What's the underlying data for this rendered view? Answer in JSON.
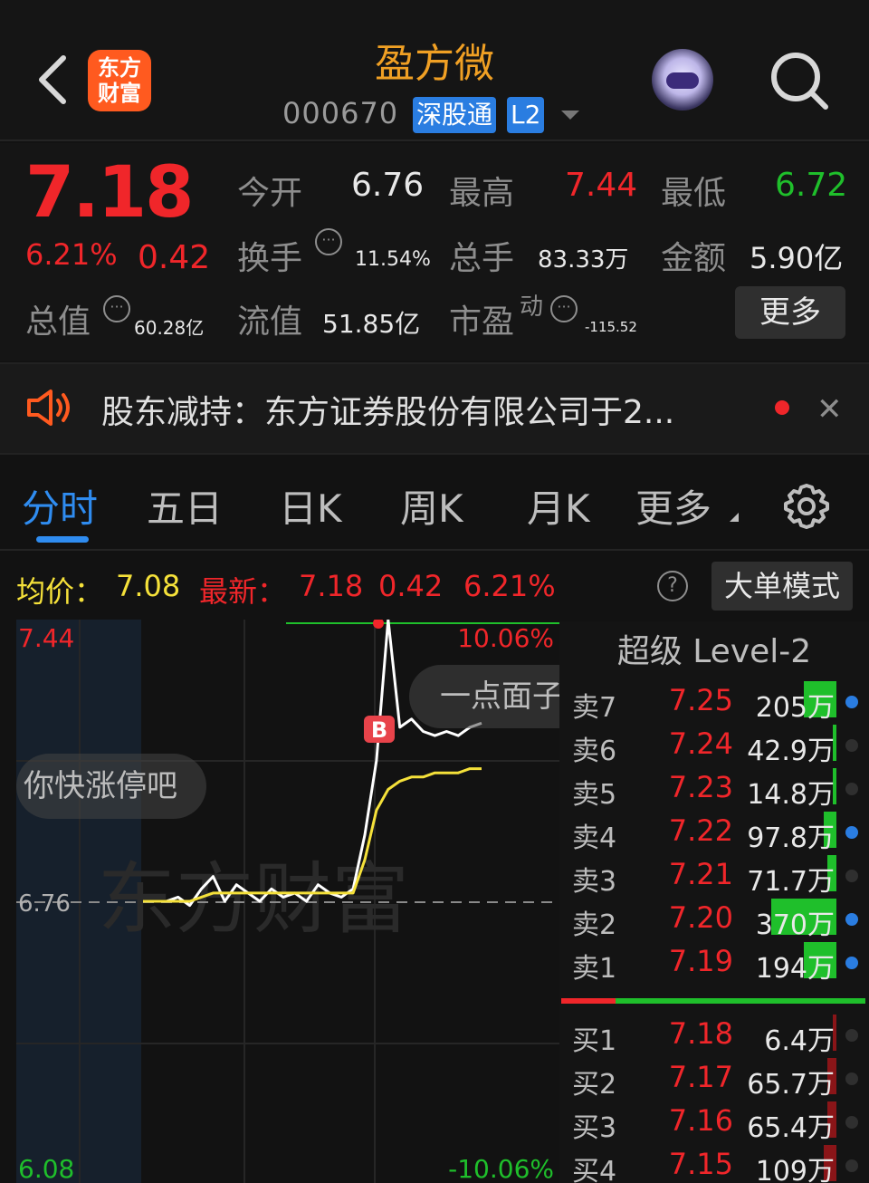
{
  "header": {
    "logo_line1": "东方",
    "logo_line2": "财富",
    "stock_name": "盈方微",
    "stock_code": "000670",
    "badge_sgt": "深股通",
    "badge_l2": "L2"
  },
  "quote": {
    "price": "7.18",
    "change_pct": "6.21%",
    "change": "0.42",
    "open_label": "今开",
    "open": "6.76",
    "high_label": "最高",
    "high": "7.44",
    "low_label": "最低",
    "low": "6.72",
    "turnover_label": "换手",
    "turnover": "11.54%",
    "volume_label": "总手",
    "volume": "83.33万",
    "amount_label": "金额",
    "amount": "5.90亿",
    "mktcap_label": "总值",
    "mktcap": "60.28亿",
    "float_label": "流值",
    "float_cap": "51.85亿",
    "pe_label": "市盈",
    "pe_sup": "动",
    "pe": "-115.52",
    "more_label": "更多",
    "info_glyph": "···"
  },
  "news": {
    "text": "股东减持：东方证券股份有限公司于2..."
  },
  "tabs": [
    "分时",
    "五日",
    "日K",
    "周K",
    "月K",
    "更多"
  ],
  "avg_row": {
    "avg_label": "均价：",
    "avg": "7.08",
    "latest_label": "最新：",
    "latest": "7.18",
    "change": "0.42",
    "change_pct": "6.21%",
    "help": "?",
    "big_order_mode": "大单模式"
  },
  "chart": {
    "y_top": "7.44",
    "y_mid": "6.76",
    "y_bottom": "6.08",
    "pct_top": "10.06%",
    "pct_bottom": "-10.06%",
    "watermark": "东方财富",
    "buy_marker": "B",
    "bubble1": "你快涨停吧",
    "bubble2": "一点面子",
    "colors": {
      "price_line": "#ffffff",
      "avg_line": "#f5e13a",
      "up": "#f0262a",
      "down": "#1fbf2b"
    }
  },
  "chart_data": {
    "type": "line",
    "ylim": [
      6.08,
      7.44
    ],
    "prev_close": 6.76,
    "series": [
      {
        "values": [
          6.76,
          6.76,
          6.76,
          6.77,
          6.75,
          6.79,
          6.82,
          6.76,
          6.8,
          6.78,
          6.76,
          6.79,
          6.77,
          6.78,
          6.76,
          6.8,
          6.78,
          6.77,
          6.79,
          6.92,
          7.1,
          7.44,
          7.18,
          7.2,
          7.17,
          7.16,
          7.17,
          7.16,
          7.18,
          7.19
        ]
      },
      {
        "values": [
          6.76,
          6.76,
          6.76,
          6.76,
          6.76,
          6.77,
          6.78,
          6.78,
          6.78,
          6.78,
          6.78,
          6.78,
          6.78,
          6.78,
          6.78,
          6.78,
          6.78,
          6.78,
          6.78,
          6.86,
          6.98,
          7.03,
          7.05,
          7.06,
          7.06,
          7.07,
          7.07,
          7.07,
          7.08,
          7.08
        ]
      }
    ]
  },
  "book": {
    "title": "超级 Level-2",
    "asks": [
      {
        "label": "卖7",
        "price": "7.25",
        "vol": "205万",
        "bar": 0.3,
        "dot": "blue"
      },
      {
        "label": "卖6",
        "price": "7.24",
        "vol": "42.9万",
        "bar": 0.02,
        "dot": "grey"
      },
      {
        "label": "卖5",
        "price": "7.23",
        "vol": "14.8万",
        "bar": 0.01,
        "dot": "grey"
      },
      {
        "label": "卖4",
        "price": "7.22",
        "vol": "97.8万",
        "bar": 0.12,
        "dot": "blue"
      },
      {
        "label": "卖3",
        "price": "7.21",
        "vol": "71.7万",
        "bar": 0.08,
        "dot": "grey"
      },
      {
        "label": "卖2",
        "price": "7.20",
        "vol": "370万",
        "bar": 0.6,
        "dot": "blue"
      },
      {
        "label": "卖1",
        "price": "7.19",
        "vol": "194万",
        "bar": 0.3,
        "dot": "blue"
      }
    ],
    "bids": [
      {
        "label": "买1",
        "price": "7.18",
        "vol": "6.4万",
        "bar": 0.01,
        "dot": "grey"
      },
      {
        "label": "买2",
        "price": "7.17",
        "vol": "65.7万",
        "bar": 0.08,
        "dot": "grey"
      },
      {
        "label": "买3",
        "price": "7.16",
        "vol": "65.4万",
        "bar": 0.08,
        "dot": "grey"
      },
      {
        "label": "买4",
        "price": "7.15",
        "vol": "109万",
        "bar": 0.12,
        "dot": "grey"
      }
    ]
  }
}
